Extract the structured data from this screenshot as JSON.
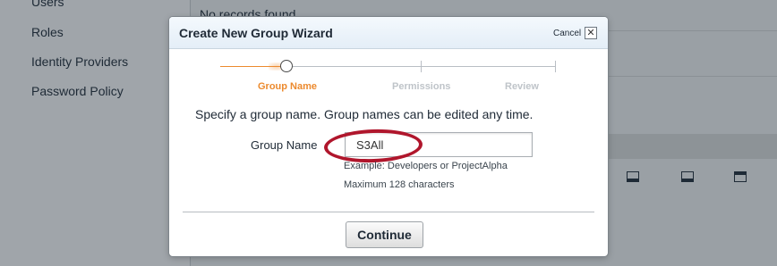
{
  "background": {
    "sidebar": {
      "items": [
        "Users",
        "Roles",
        "Identity Providers",
        "Password Policy"
      ]
    },
    "main": {
      "empty_message": "No records found."
    }
  },
  "wizard": {
    "title": "Create New Group Wizard",
    "cancel_label": "Cancel",
    "close_glyph": "✕",
    "steps": [
      {
        "label": "Group Name",
        "state": "active"
      },
      {
        "label": "Permissions",
        "state": "pending"
      },
      {
        "label": "Review",
        "state": "pending"
      }
    ],
    "intro": "Specify a group name. Group names can be edited any time.",
    "field": {
      "label": "Group Name",
      "value": "S3All",
      "hint_example": "Example: Developers or ProjectAlpha",
      "hint_limit": "Maximum 128 characters"
    },
    "continue_label": "Continue",
    "colors": {
      "accent": "#ec8a2e",
      "annotation": "#b0162c"
    }
  }
}
